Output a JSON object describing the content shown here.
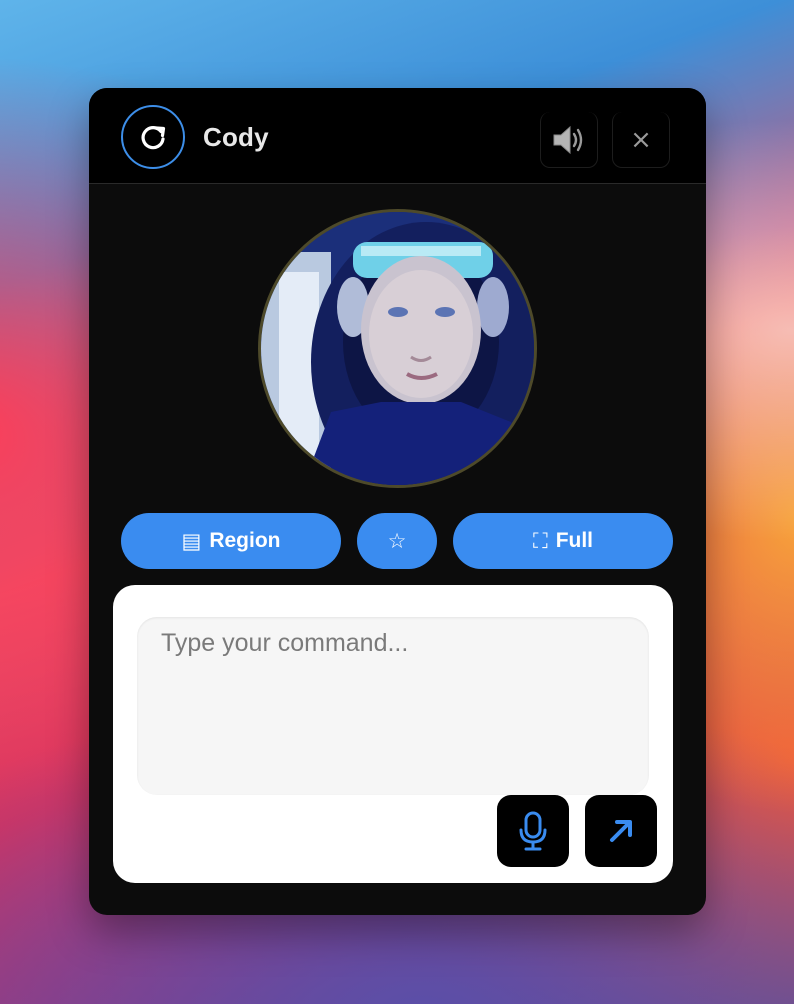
{
  "app": {
    "name": "Cody",
    "logo_icon": "refresh-icon",
    "accent_color": "#3a8cf0"
  },
  "titlebar": {
    "speaker_icon": "speaker-icon",
    "close_glyph": "×"
  },
  "avatar": {
    "icon": "user-photo"
  },
  "actions": {
    "region_glyph": "▤",
    "region_label": "Region",
    "star_glyph": "☆",
    "full_glyph": "⛶",
    "full_label": "Full"
  },
  "command": {
    "placeholder": "Type your command...",
    "value": "",
    "mic_icon": "microphone-icon",
    "send_icon": "send-arrow-icon"
  }
}
